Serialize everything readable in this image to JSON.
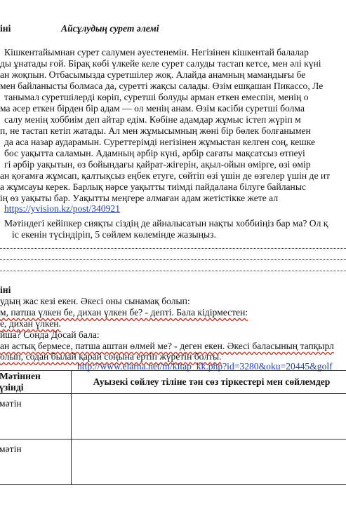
{
  "header": {
    "left": "іні",
    "title": "Айсұлудың сурет әлемі"
  },
  "paragraph_lines": [
    "Кішкентайымнан сурет салумен әуестенемін. Негізінен кішкентай балалар",
    "ды ұнатады ғой. Бірақ көбі үлкейе келе сурет салуды тастап кетсе, мен әлі күні",
    "ан жоқпын. Отбасымызда суретшілер жоқ. Алайда анамның мамандығы бе",
    "мен байланысты болмаса да, суретті жақсы салады. Өзім ешқашан Пикассо, Ле",
    "танымал суретшілерді көріп, суретші болуды арман еткен емеспін, менің о",
    "ма әсер еткен бірден бір адам — ол менің анам. Өзім кәсіби суретші болма",
    "салу менің хоббиім деп айтар едім. Көбіне адамдар жұмыс істеп жүріп м",
    "п, не тастап кетіп жатады. Ал мен жұмысымның жөні бір бөлек болғанымен",
    "да аса назар аударамын. Суреттерімді негізінен жұмыстан келген соң, кешке",
    "бос уақытта саламын. Адамның әрбір күні, әрбір сағаты мақсатсыз өтпеуі",
    "гі әрбір уақытын, өз бойындағы қайрат-жігерін, ақыл-ойын өмірге, өзі өмір",
    "ан қоғамға жұмсап, қалтықсыз еңбек етуге, сөйтіп өзі үшін де өзгелер үшін де ит",
    "а жұмсауы керек. Барлық нәрсе уақытты тиімді пайдалана білуге байланыс",
    "ің өз уақыты бар. Уақытты меңгере алмаған адам жетістікке жете ал"
  ],
  "source_link": "https://yvision.kz/post/340921",
  "question": {
    "line1": "Мәтіндегі кейіпкер сияқты сіздің де айналысатын нақты хоббиіңіз бар ма? Ол қ",
    "line2": "іс екенін түсіндіріп,  5 сөйлем көлемінде жазыңыз."
  },
  "section2": {
    "heading": "іні",
    "lines": [
      "удың жас кезі екен. Әкесі оны сынамақ болып:",
      "м, патша үлкен бе, дихан үлкен бе? - депті. Бала кідірместен:",
      "е, дихан үлкен.",
      "йша? Сонда Досай бала:",
      "ан астық бермесе, патша аштан өлмей ме? - деген екен. Әкесі баласының тапқырл",
      "олып, содан былай қарай соңына ертіп жүретін болты."
    ],
    "link": "http://www.elarna.net/m/kitap_kk.php?id=3280&oku=20445&golf"
  },
  "table": {
    "header_col1": "Мәтіннен үзінді",
    "header_col2": "Ауызекі сөйлеу тіліне тән сөз тіркестері мен сөйлемдер",
    "rows": [
      {
        "col1": "мәтін",
        "col2": ""
      },
      {
        "col1": "мәтін",
        "col2": ""
      }
    ]
  }
}
